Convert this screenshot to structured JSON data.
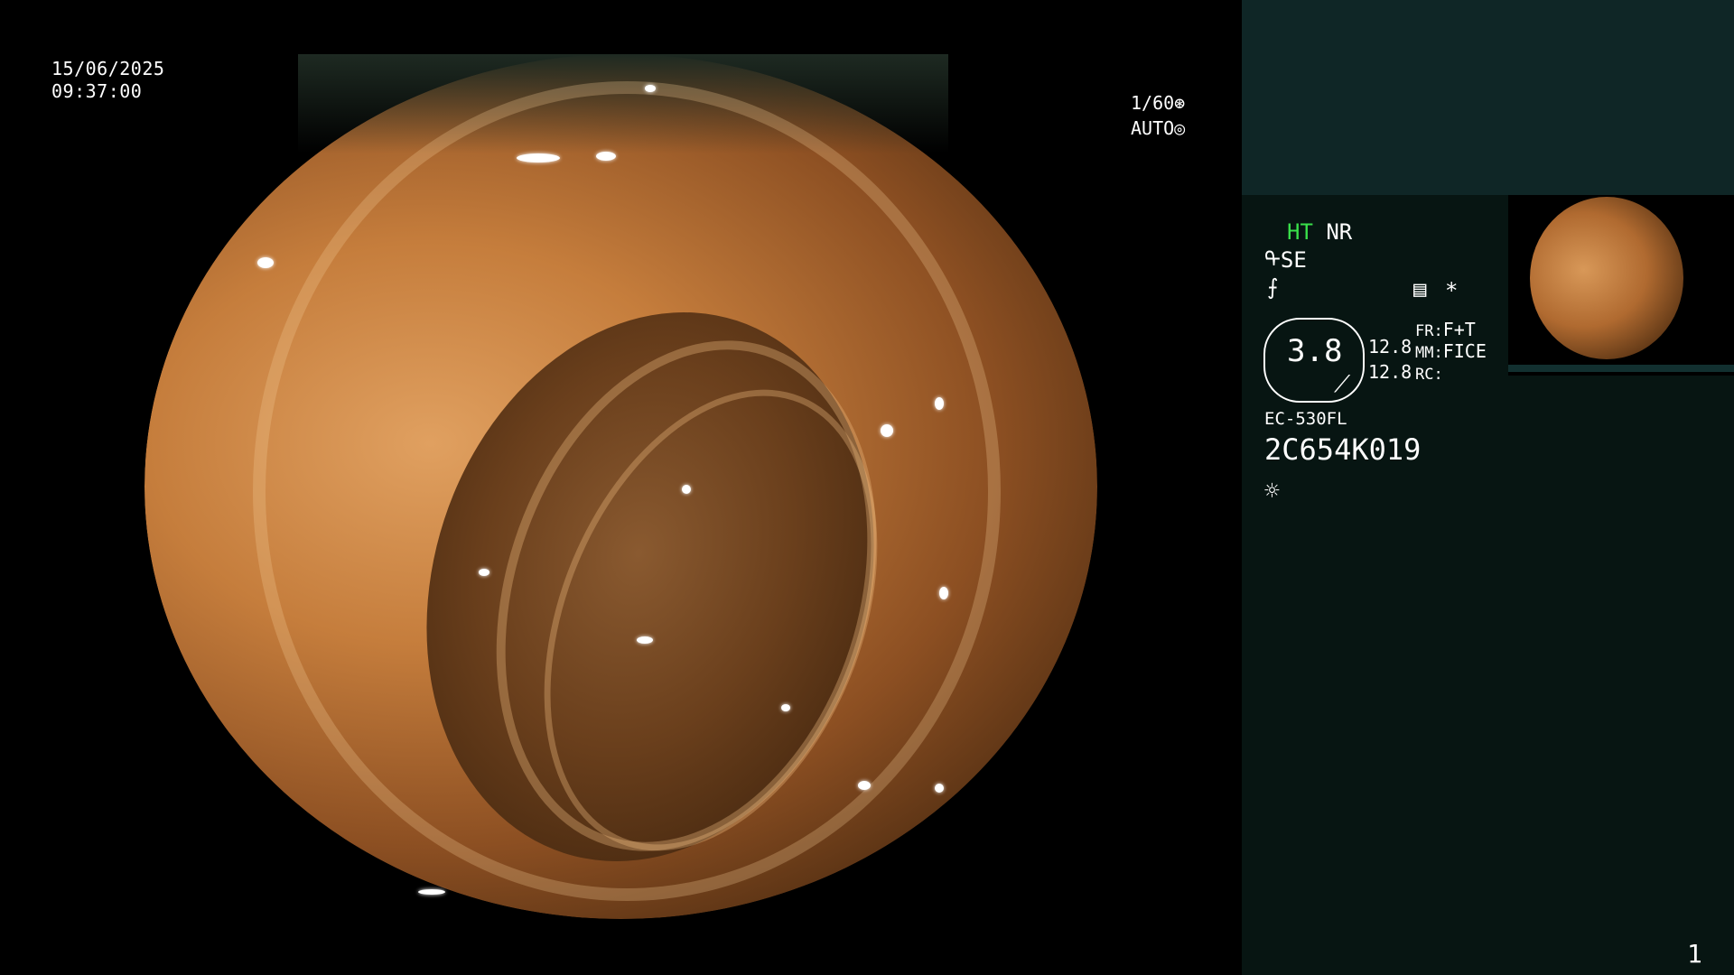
{
  "overlay": {
    "date": "15/06/2025",
    "time": "09:37:00",
    "shutter": "1/60",
    "shutter_icon": "aperture-icon",
    "exposure": "AUTO",
    "exposure_icon": "iris-icon"
  },
  "panel": {
    "mode_ht": "HT",
    "mode_nr": "NR",
    "se": "SE",
    "se_icon": "structure-enhancement-icon",
    "zoom": "3.8",
    "val1": "12.8",
    "val2": "12.8",
    "fr_label": "FR:",
    "fr_value": "F+T",
    "mm_label": "MM:",
    "mm_value": "FICE",
    "rc_label": "RC:",
    "scope_model": "EC-530FL",
    "serial": "2C654K019",
    "asterisk": "*",
    "page_number": "1"
  },
  "colors": {
    "panel_bg": "#071512",
    "panel_top": "#0f2626",
    "accent_green": "#39e04a"
  }
}
